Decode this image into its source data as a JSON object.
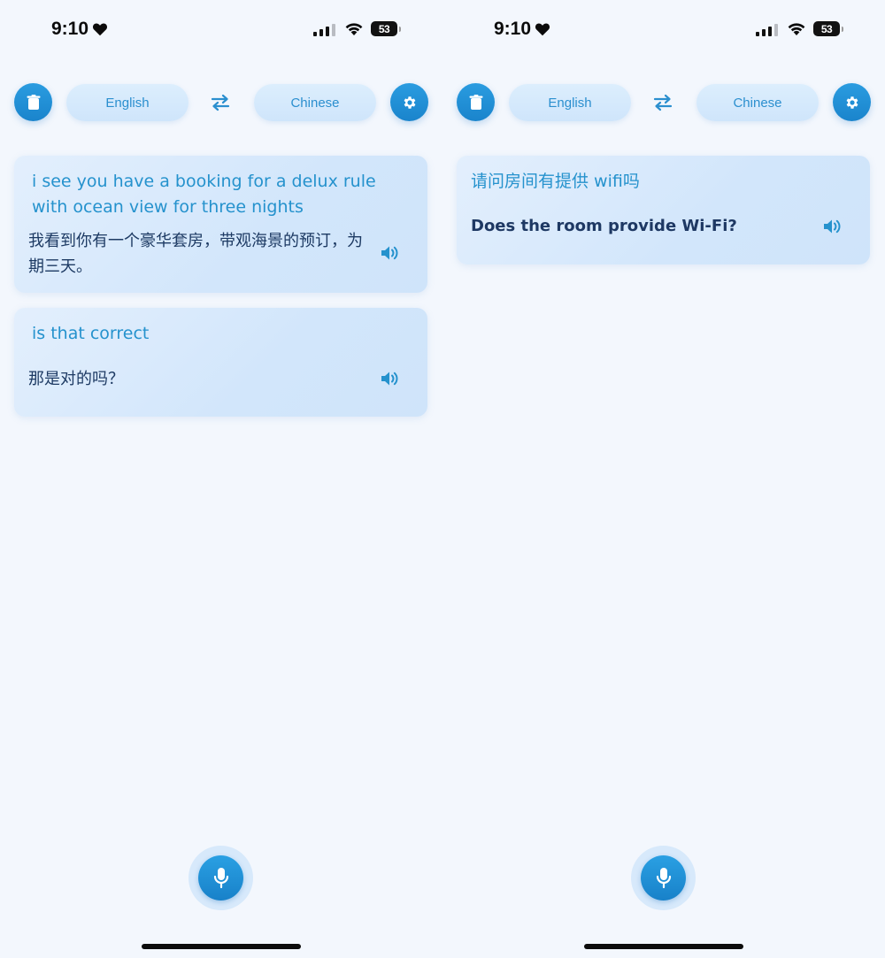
{
  "screens": [
    {
      "status": {
        "time": "9:10",
        "battery": "53"
      },
      "toolbar": {
        "source_lang": "English",
        "target_lang": "Chinese"
      },
      "cards": [
        {
          "source": "i see you have a booking for a delux rule with ocean view for three nights",
          "translation": "我看到你有一个豪华套房，带观海景的预订，为期三天。"
        },
        {
          "source": "is that correct",
          "translation": "那是对的吗？"
        }
      ]
    },
    {
      "status": {
        "time": "9:10",
        "battery": "53"
      },
      "toolbar": {
        "source_lang": "English",
        "target_lang": "Chinese"
      },
      "cards": [
        {
          "source": "请问房间有提供 wifi吗",
          "translation": "Does the room provide Wi-Fi?"
        }
      ]
    }
  ],
  "colors": {
    "accent": "#1f90d6",
    "source_text": "#2592cd",
    "target_text": "#1d3a63",
    "background": "#f3f7fd",
    "card": "#d6e8fb"
  },
  "icons": [
    "heart-icon",
    "signal-icon",
    "wifi-icon",
    "battery-icon",
    "trash-icon",
    "swap-icon",
    "gear-icon",
    "speaker-icon",
    "microphone-icon"
  ]
}
